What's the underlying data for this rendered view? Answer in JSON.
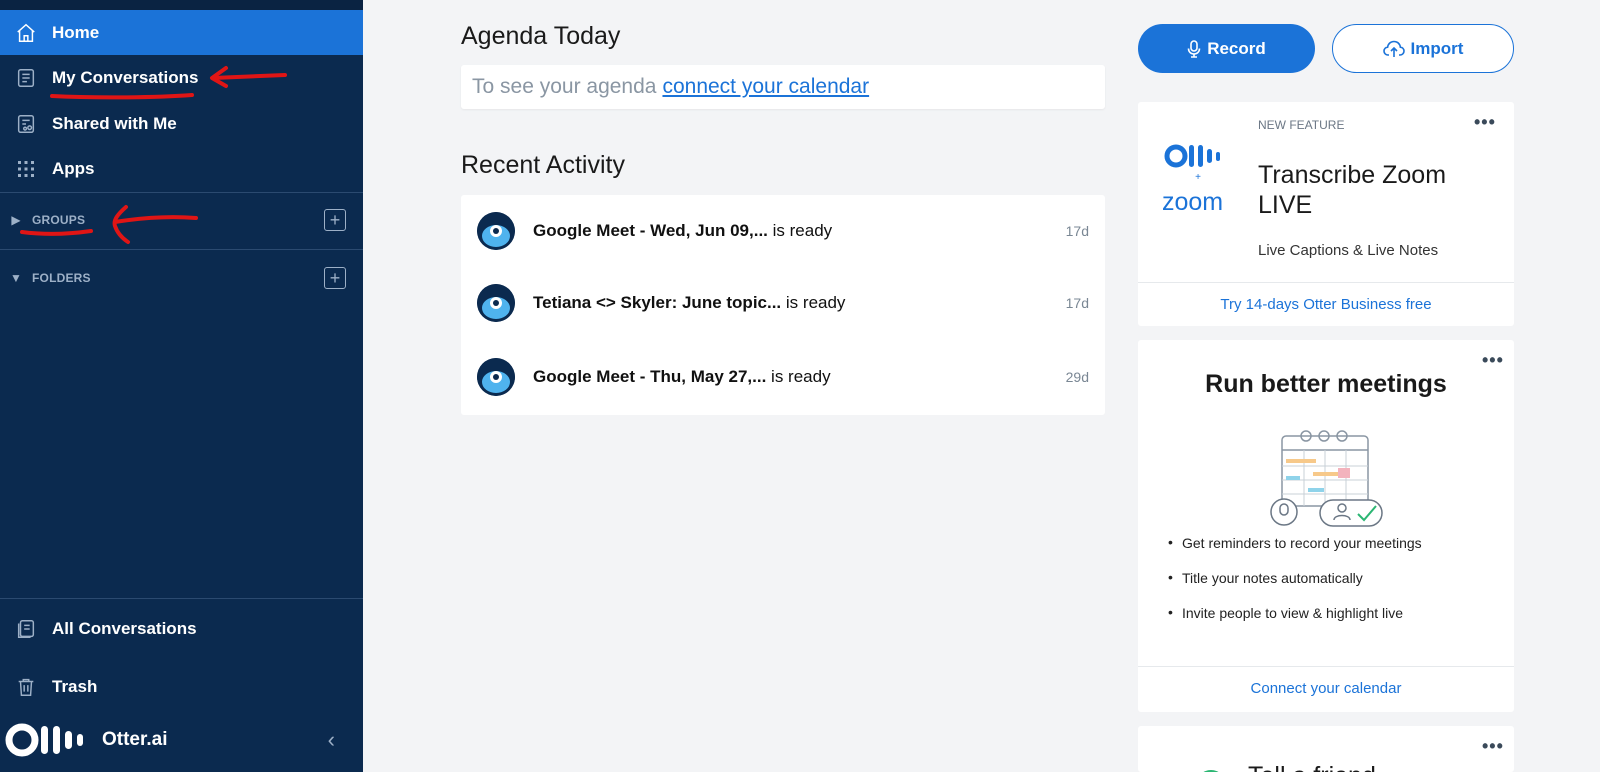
{
  "sidebar": {
    "nav": [
      {
        "label": "Home",
        "icon": "home-icon"
      },
      {
        "label": "My Conversations",
        "icon": "conversations-icon"
      },
      {
        "label": "Shared with Me",
        "icon": "shared-icon"
      },
      {
        "label": "Apps",
        "icon": "apps-grid-icon"
      }
    ],
    "groups_label": "GROUPS",
    "folders_label": "FOLDERS",
    "all_conversations": "All Conversations",
    "trash": "Trash",
    "brand": "Otter.ai"
  },
  "main": {
    "agenda_title": "Agenda Today",
    "agenda_prefix": "To see your agenda",
    "agenda_link": "connect your calendar",
    "recent_title": "Recent Activity",
    "activity": [
      {
        "title": "Google Meet - Wed, Jun 09,...",
        "status": "is ready",
        "age": "17d"
      },
      {
        "title": "Tetiana <> Skyler: June topic...",
        "status": "is ready",
        "age": "17d"
      },
      {
        "title": "Google Meet - Thu, May 27,...",
        "status": "is ready",
        "age": "29d"
      }
    ]
  },
  "right": {
    "record_label": "Record",
    "import_label": "Import",
    "feature_card": {
      "tag": "NEW FEATURE",
      "title_line1": "Transcribe Zoom",
      "title_line2": "LIVE",
      "subtitle": "Live Captions & Live Notes",
      "zoom_word": "zoom",
      "cta": "Try 14-days Otter Business free"
    },
    "meetings_card": {
      "title": "Run better meetings",
      "bullets": [
        "Get reminders to record your meetings",
        "Title your notes automatically",
        "Invite people to view & highlight live"
      ],
      "cta": "Connect your calendar"
    },
    "third_card": {
      "title": "Tell a friend"
    }
  },
  "colors": {
    "sidebar_bg": "#0b2a4f",
    "active_bg": "#1b73d8",
    "accent": "#1b73d8",
    "annotation_red": "#e01515"
  }
}
